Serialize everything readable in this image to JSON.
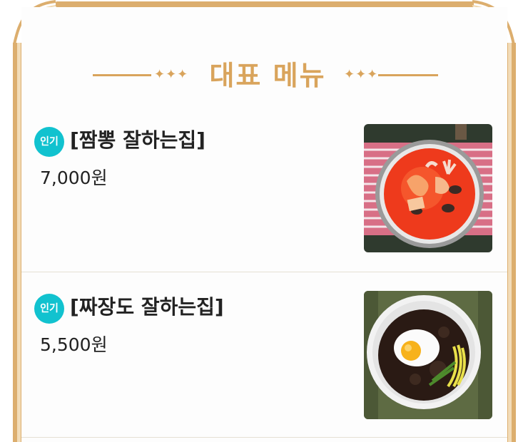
{
  "header": {
    "title": "대표 메뉴",
    "sparkles_left": "✦✦✦",
    "sparkles_right": "✦✦✦"
  },
  "menu": {
    "items": [
      {
        "badge": "인기",
        "name": "[짬뽕 잘하는집]",
        "price": "7,000원",
        "image_icon": "jjamppong-photo"
      },
      {
        "badge": "인기",
        "name": "[짜장도 잘하는집]",
        "price": "5,500원",
        "image_icon": "jjajangmyeon-photo"
      }
    ]
  },
  "colors": {
    "gold": "#d9a45c",
    "badge": "#11c2cf",
    "text": "#222222"
  }
}
